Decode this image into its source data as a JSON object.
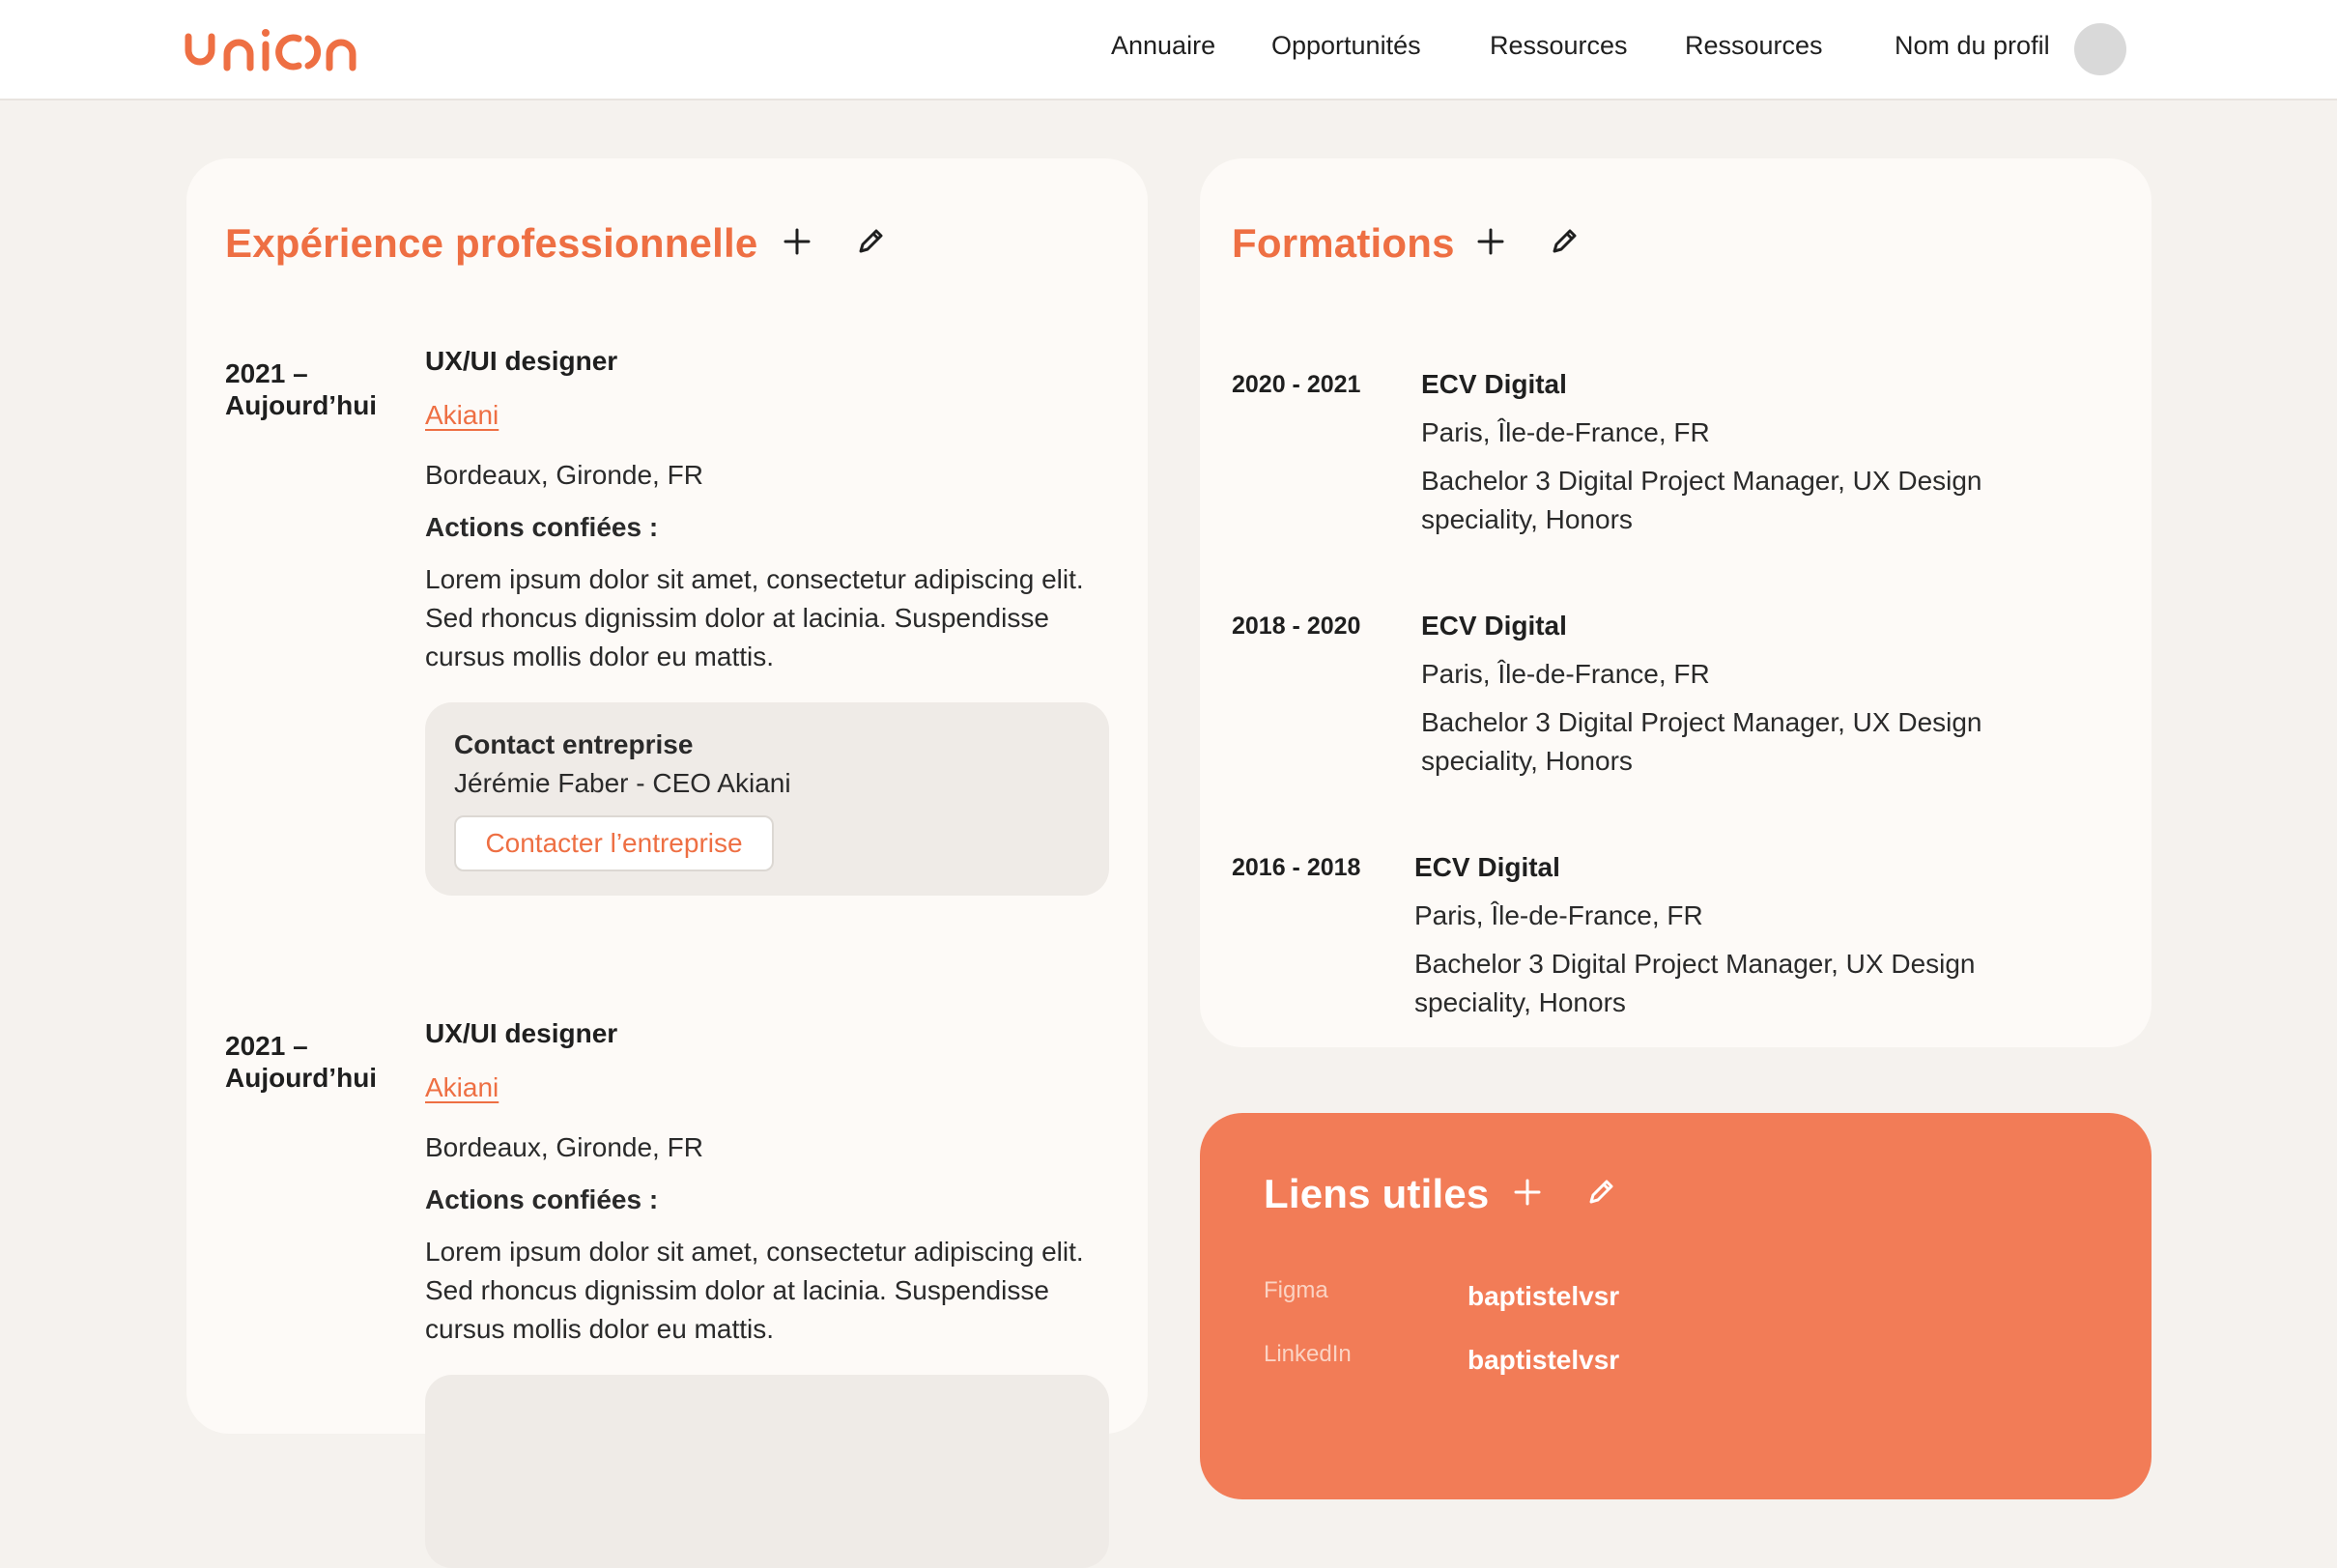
{
  "header": {
    "logo_text": "union",
    "nav": [
      "Annuaire",
      "Opportunités",
      "Ressources",
      "Ressources"
    ],
    "profile_name": "Nom du profil",
    "brand_color": "#ee6f43"
  },
  "experience": {
    "title": "Expérience professionnelle",
    "entries": [
      {
        "date_start": "2021 –",
        "date_end": "Aujourd’hui",
        "job": "UX/UI designer",
        "company": "Akiani",
        "location": "Bordeaux, Gironde, FR",
        "actions_label": "Actions confiées :",
        "description": "Lorem ipsum dolor sit amet, consectetur adipiscing elit. Sed rhoncus dignissim dolor at lacinia. Suspendisse cursus mollis dolor eu mattis.",
        "contact_title": "Contact entreprise",
        "contact_person": "Jérémie Faber - CEO Akiani",
        "contact_button": "Contacter l’entreprise"
      },
      {
        "date_start": "2021 –",
        "date_end": "Aujourd’hui",
        "job": "UX/UI designer",
        "company": "Akiani",
        "location": "Bordeaux, Gironde, FR",
        "actions_label": "Actions confiées :",
        "description": "Lorem ipsum dolor sit amet, consectetur adipiscing elit. Sed rhoncus dignissim dolor at lacinia. Suspendisse cursus mollis dolor eu mattis."
      }
    ]
  },
  "formations": {
    "title": "Formations",
    "entries": [
      {
        "date": "2020 - 2021",
        "school": "ECV Digital",
        "location": "Paris, Île-de-France, FR",
        "degree": "Bachelor 3 Digital Project Manager, UX Design speciality, Honors"
      },
      {
        "date": "2018 - 2020",
        "school": "ECV Digital",
        "location": "Paris, Île-de-France, FR",
        "degree": "Bachelor 3 Digital Project Manager, UX Design speciality, Honors"
      },
      {
        "date": "2016 - 2018",
        "school": "ECV Digital",
        "location": "Paris, Île-de-France, FR",
        "degree": "Bachelor 3 Digital Project Manager, UX Design speciality, Honors"
      }
    ]
  },
  "links": {
    "title": "Liens utiles",
    "items": [
      {
        "label": "Figma",
        "value": "baptistelvsr"
      },
      {
        "label": "LinkedIn",
        "value": "baptistelvsr"
      }
    ]
  }
}
